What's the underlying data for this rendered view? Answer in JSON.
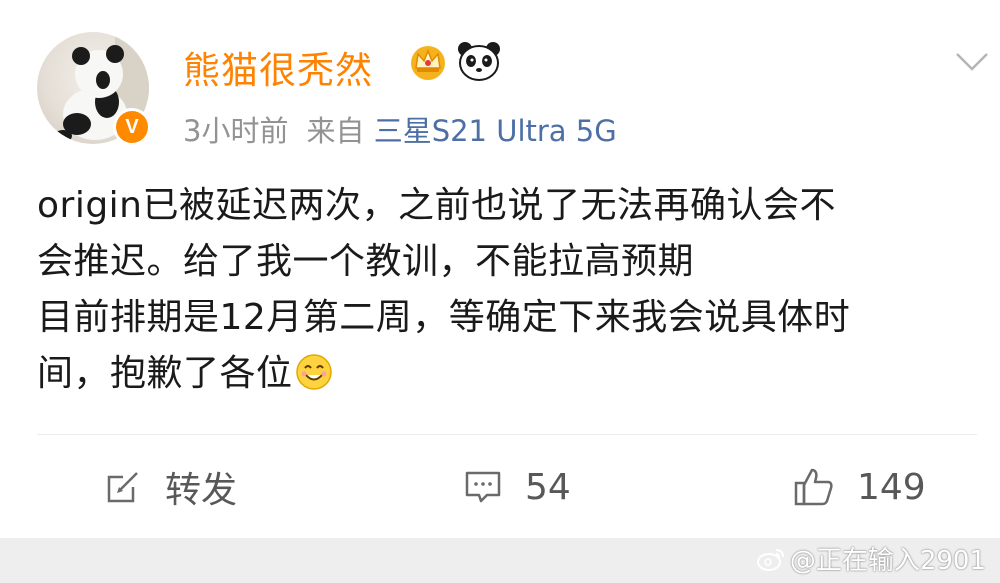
{
  "post": {
    "author": {
      "name": "熊猫很秃然",
      "avatar_icon": "panda-avatar",
      "verified_badge": "V",
      "badges": [
        "crown-icon",
        "panda-icon"
      ]
    },
    "meta": {
      "time": "3小时前",
      "source_prefix": "来自",
      "device": "三星S21 Ultra 5G"
    },
    "body": {
      "line1": "origin已被延迟两次，之前也说了无法再确认会不",
      "line2": "会推迟。给了我一个教训，不能拉高预期",
      "line3": "目前排期是12月第二周，等确定下来我会说具体时",
      "line4": "间，抱歉了各位",
      "trailing_emoji": "smile-face-icon"
    },
    "actions": {
      "repost_label": "转发",
      "comment_count": "54",
      "like_count": "149"
    }
  },
  "watermark": {
    "text": "@正在输入2901",
    "logo_icon": "weibo-logo-icon"
  },
  "colors": {
    "username": "#ff8200",
    "device_link": "#4d6fa6",
    "meta_gray": "#939393",
    "body_text": "#1a1a1a",
    "action_gray": "#585858",
    "verified_orange": "#ff8a00"
  }
}
